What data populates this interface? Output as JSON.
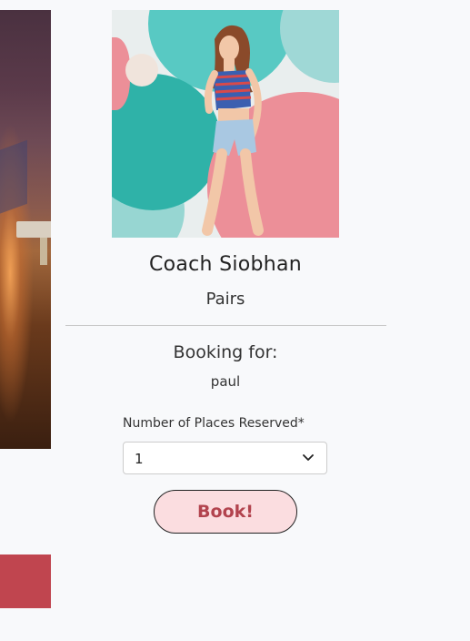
{
  "coach": {
    "name": "Coach Siobhan",
    "session_type": "Pairs"
  },
  "booking": {
    "heading": "Booking for:",
    "user": "paul"
  },
  "places": {
    "label": "Number of Places Reserved*",
    "selected": "1"
  },
  "actions": {
    "book_label": "Book!"
  },
  "colors": {
    "accent": "#c0454f",
    "button_bg": "#fbdde0",
    "button_text": "#b2434e",
    "page_bg": "#f8f9fb"
  }
}
